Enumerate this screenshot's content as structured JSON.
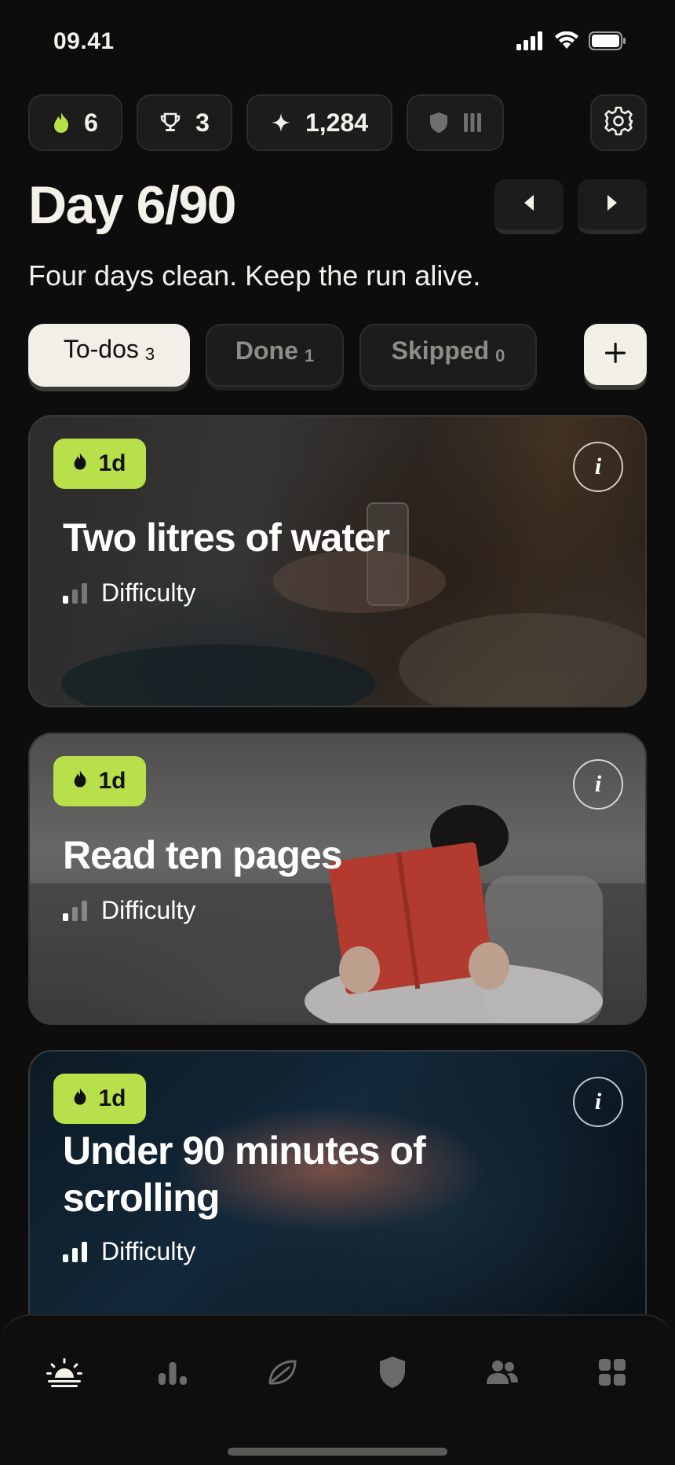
{
  "status_bar": {
    "time": "09.41"
  },
  "stats": {
    "streak": "6",
    "trophies": "3",
    "points": "1,284"
  },
  "header": {
    "day_title": "Day 6/90",
    "subtitle": "Four days clean. Keep the run alive."
  },
  "tabs": [
    {
      "label": "To-dos",
      "count": "3",
      "active": true
    },
    {
      "label": "Done",
      "count": "1",
      "active": false
    },
    {
      "label": "Skipped",
      "count": "0",
      "active": false
    }
  ],
  "cards": [
    {
      "badge": "1d",
      "title": "Two litres of water",
      "difficulty_label": "Difficulty",
      "difficulty_level": 1
    },
    {
      "badge": "1d",
      "title": "Read ten pages",
      "difficulty_label": "Difficulty",
      "difficulty_level": 1
    },
    {
      "badge": "1d",
      "title_line1": "Under 90 minutes of",
      "title_line2": "scrolling",
      "difficulty_label": "Difficulty",
      "difficulty_level": 3
    }
  ],
  "bottom_nav": {
    "items": [
      "sunrise-icon",
      "stats-icon",
      "leaf-icon",
      "shield-icon",
      "community-icon",
      "apps-icon"
    ]
  },
  "colors": {
    "background": "#0d0d0d",
    "accent": "#b7e04a",
    "pill": "#1b1c1b",
    "active_tab": "#f1efe8"
  }
}
